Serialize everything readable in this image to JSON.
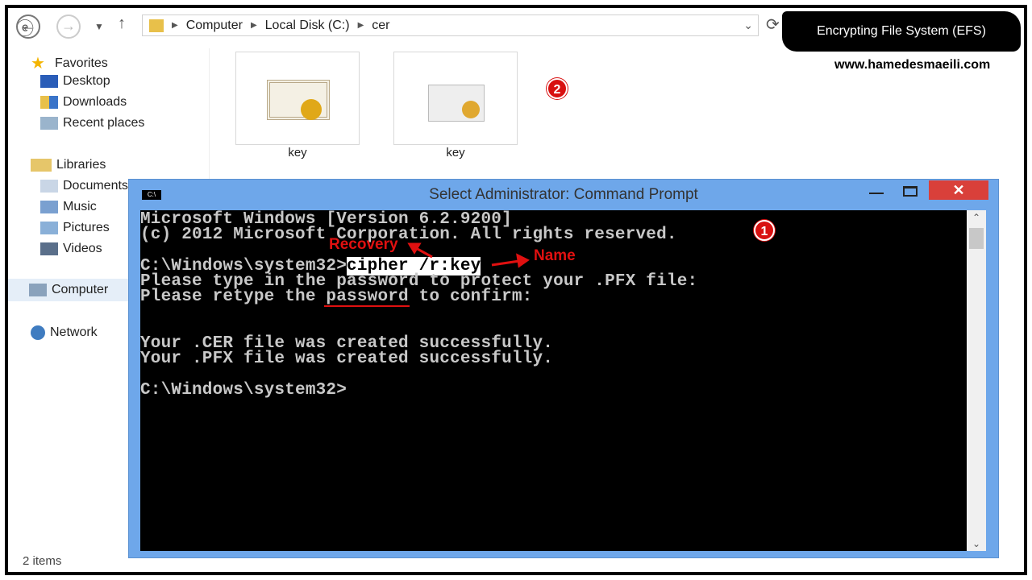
{
  "explorer": {
    "breadcrumb": [
      "Computer",
      "Local Disk (C:)",
      "cer"
    ],
    "sidebar": {
      "favorites": "Favorites",
      "favorite_items": [
        "Desktop",
        "Downloads",
        "Recent places"
      ],
      "libraries": "Libraries",
      "library_items": [
        "Documents",
        "Music",
        "Pictures",
        "Videos"
      ],
      "computer": "Computer",
      "network": "Network"
    },
    "files": [
      {
        "name": "key",
        "icon": "certificate-icon"
      },
      {
        "name": "key",
        "icon": "pfx-key-envelope-icon"
      }
    ],
    "status": "2 items"
  },
  "cmd": {
    "title": "Select Administrator: Command Prompt",
    "lines": [
      "Microsoft Windows [Version 6.2.9200]",
      "(c) 2012 Microsoft Corporation. All rights reserved.",
      "C:\\Windows\\system32>",
      "cipher /r:key",
      "Please type in the password to protect your .PFX file:",
      "Please retype the password to confirm:",
      "Your .CER file was created successfully.",
      "Your .PFX file was created successfully.",
      "C:\\Windows\\system32>"
    ]
  },
  "annotations": {
    "recovery": "Recovery",
    "name": "Name",
    "badge1": "1",
    "badge2": "2",
    "accent": "#e01010"
  },
  "watermark": {
    "title": "Encrypting File System (EFS)",
    "website": "www.hamedesmaeili.com"
  }
}
